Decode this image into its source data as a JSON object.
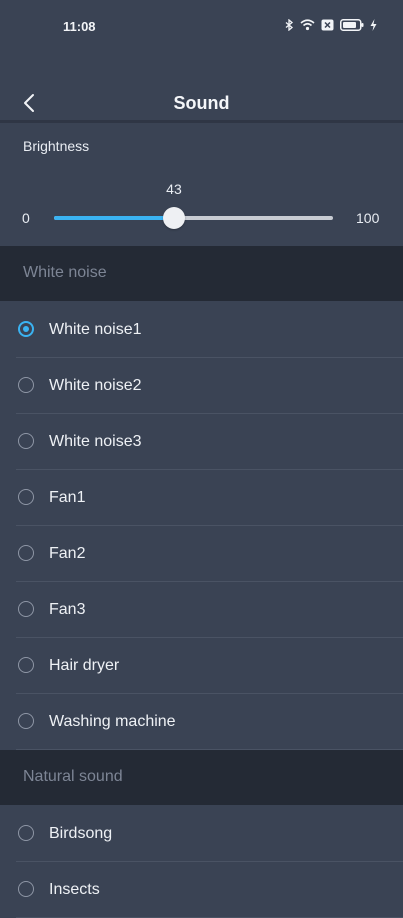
{
  "status_bar": {
    "time": "11:08",
    "icons": [
      "bluetooth-icon",
      "wifi-icon",
      "close-box-icon",
      "battery-icon",
      "charging-icon"
    ]
  },
  "header": {
    "title": "Sound",
    "back_icon": "back-chevron-icon"
  },
  "brightness": {
    "label": "Brightness",
    "value": "43",
    "min": "0",
    "max": "100",
    "value_num": 43,
    "min_num": 0,
    "max_num": 100,
    "accent": "#3ab3f2"
  },
  "sections": [
    {
      "title": "White noise",
      "items": [
        {
          "label": "White noise1",
          "selected": true
        },
        {
          "label": "White noise2",
          "selected": false
        },
        {
          "label": "White noise3",
          "selected": false
        },
        {
          "label": "Fan1",
          "selected": false
        },
        {
          "label": "Fan2",
          "selected": false
        },
        {
          "label": "Fan3",
          "selected": false
        },
        {
          "label": "Hair dryer",
          "selected": false
        },
        {
          "label": "Washing machine",
          "selected": false
        }
      ]
    },
    {
      "title": "Natural sound",
      "items": [
        {
          "label": "Birdsong",
          "selected": false
        },
        {
          "label": "Insects",
          "selected": false
        }
      ]
    }
  ]
}
